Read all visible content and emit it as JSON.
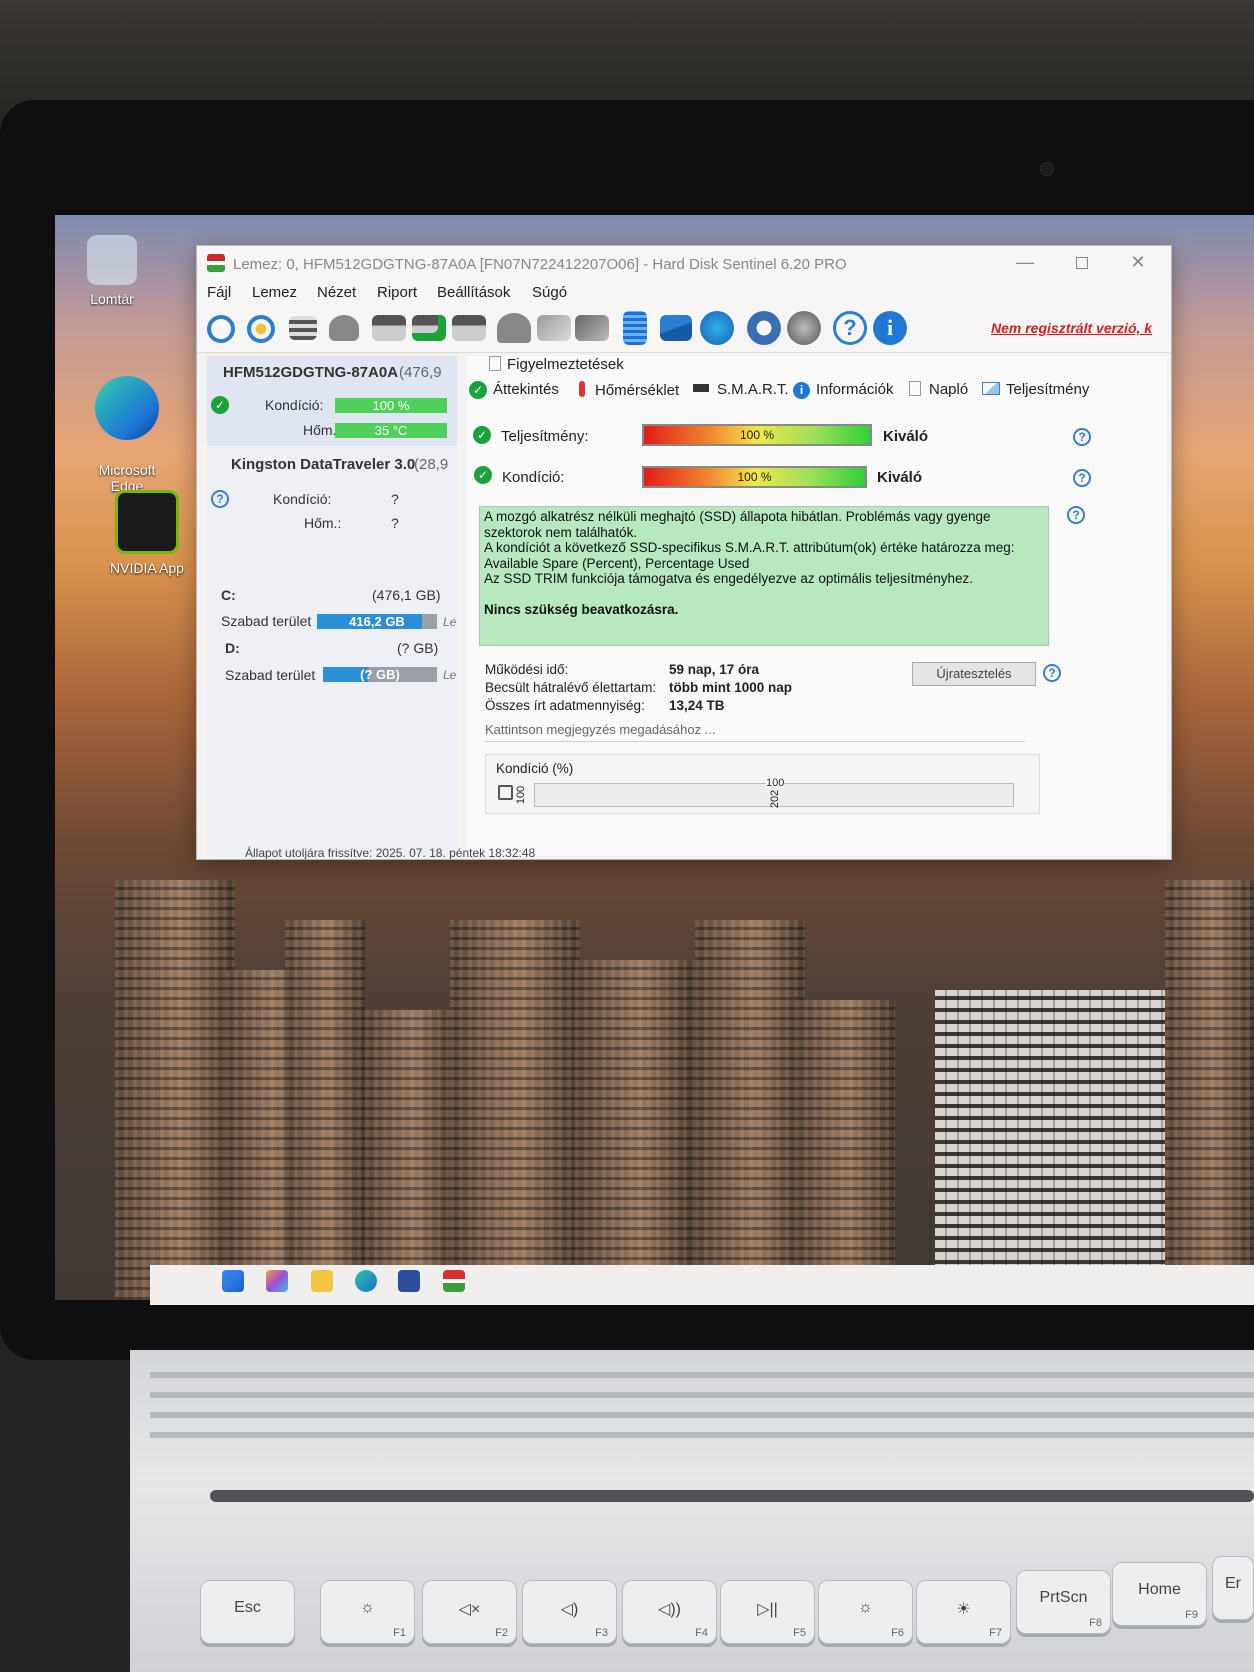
{
  "window": {
    "title": "Lemez: 0, HFM512GDGTNG-87A0A [FN07N722412207O06]  -  Hard Disk Sentinel 6.20 PRO",
    "minimize": "—",
    "close": "✕"
  },
  "desktop": {
    "icons": [
      {
        "label": "Lomtár"
      },
      {
        "label": "Microsoft\nEdge"
      },
      {
        "label": "NVIDIA App"
      }
    ]
  },
  "menu": [
    "Fájl",
    "Lemez",
    "Nézet",
    "Riport",
    "Beállítások",
    "Súgó"
  ],
  "toolbar": {
    "unregistered": "Nem regisztrált verzió, k",
    "help_glyph": "?",
    "info_glyph": "i"
  },
  "disks": [
    {
      "name": "HFM512GDGTNG-87A0A",
      "size": "(476,9",
      "condition_label": "Kondíció:",
      "condition_value": "100 %",
      "condition_fraction": 1.0,
      "temp_label": "Hőm.:",
      "temp_value": "35 °C"
    },
    {
      "name": "Kingston DataTraveler 3.0",
      "size": "(28,9",
      "condition_label": "Kondíció:",
      "condition_value": "?",
      "temp_label": "Hőm.:",
      "temp_value": "?"
    }
  ],
  "volumes": [
    {
      "letter": "C:",
      "size": "(476,1 GB)",
      "free_label": "Szabad terület",
      "free_value": "416,2 GB",
      "free_fraction": 0.874,
      "trail": "Le"
    },
    {
      "letter": "D:",
      "size": "(? GB)",
      "free_label": "Szabad terület",
      "free_value": "(? GB)",
      "trail": "Le"
    }
  ],
  "alerts_label": "Figyelmeztetések",
  "tabs": [
    "Áttekintés",
    "Hőmérséklet",
    "S.M.A.R.T.",
    "Információk",
    "Napló",
    "Teljesítmény"
  ],
  "overview": {
    "performance_label": "Teljesítmény:",
    "performance_value": "100 %",
    "performance_rating": "Kiváló",
    "condition_label": "Kondíció:",
    "condition_value": "100 %",
    "condition_rating": "Kiváló",
    "message_lines": [
      "A mozgó alkatrész nélküli meghajtó (SSD) állapota hibátlan. Problémás vagy gyenge",
      "szektorok nem találhatók.",
      "A kondíciót a következő SSD-specifikus S.M.A.R.T. attribútum(ok) értéke határozza meg:",
      "Available Spare (Percent), Percentage Used",
      "Az SSD TRIM funkciója támogatva és engedélyezve az optimális teljesítményhez."
    ],
    "message_conclusion": "Nincs szükség beavatkozásra.",
    "uptime_label": "Működési idő:",
    "uptime_value": "59 nap, 17 óra",
    "lifetime_label": "Becsült hátralévő élettartam:",
    "lifetime_value": "több mint 1000 nap",
    "written_label": "Összes írt adatmennyiség:",
    "written_value": "13,24 TB",
    "retest_button": "Újratesztelés",
    "note_placeholder": "Kattintson megjegyzés megadásához ...",
    "chart_title": "Kondíció  (%)",
    "chart_y_tick": "100",
    "chart_point_label": "100",
    "chart_x_tick": "202"
  },
  "status_bar": "Állapot utoljára frissítve: 2025. 07. 18. péntek 18:32:48",
  "keyboard": [
    {
      "label": "Esc",
      "fn": ""
    },
    {
      "label": "☼",
      "fn": "F1"
    },
    {
      "label": "◁×",
      "fn": "F2"
    },
    {
      "label": "◁)",
      "fn": "F3"
    },
    {
      "label": "◁))",
      "fn": "F4"
    },
    {
      "label": "▷||",
      "fn": "F5"
    },
    {
      "label": "☼",
      "fn": "F6"
    },
    {
      "label": "☀",
      "fn": "F7"
    },
    {
      "label": "PrtScn",
      "fn": "F8"
    },
    {
      "label": "Home",
      "fn": "F9"
    },
    {
      "label": "Er",
      "fn": ""
    }
  ],
  "colors": {
    "unregistered": "#d81e1e",
    "ok_green": "#1aa33a",
    "message_bg": "#b7e8c0",
    "bar_blue": "#2a8fd6",
    "bar_green": "#4fd05a"
  }
}
